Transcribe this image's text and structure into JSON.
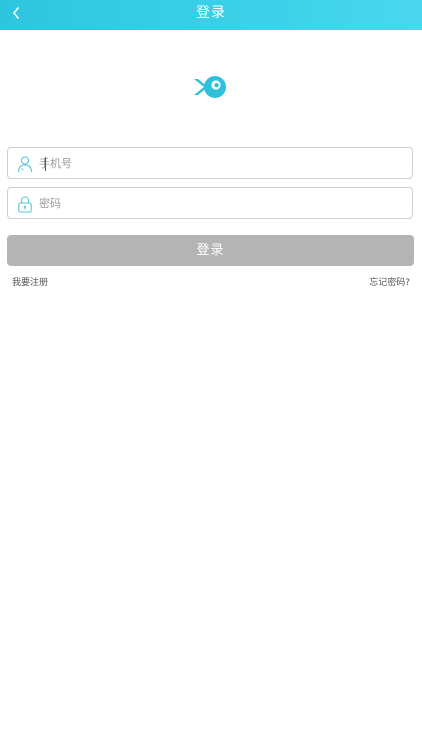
{
  "header": {
    "title": "登录",
    "back_icon": "chevron-left-icon",
    "bg_color": "#38cde6"
  },
  "logo": {
    "icon": "fish-logo-icon",
    "color": "#2fc1dc"
  },
  "form": {
    "phone": {
      "placeholder": "手机号",
      "value": "",
      "icon": "user-icon"
    },
    "password": {
      "placeholder": "密码",
      "value": "",
      "icon": "lock-icon"
    },
    "login_label": "登录",
    "login_button_color": "#b4b4b4"
  },
  "links": {
    "register": "我要注册",
    "forgot": "忘记密码?"
  }
}
